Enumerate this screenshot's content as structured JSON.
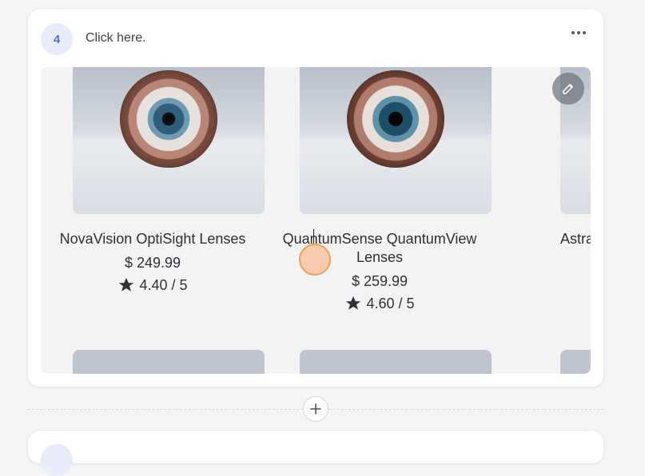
{
  "step": {
    "number": "4",
    "title": "Click here."
  },
  "products": [
    {
      "name": "NovaVision OptiSight Lenses",
      "price": "$ 249.99",
      "rating": "4.40 / 5"
    },
    {
      "name": "QuantumSense QuantumView Lenses",
      "price": "$ 259.99",
      "rating": "4.60 / 5"
    },
    {
      "name": "Astra",
      "price": "",
      "rating": ""
    }
  ],
  "icons": {
    "more": "more-horizontal-icon",
    "edit": "pencil-icon",
    "add": "plus-icon",
    "star": "star-icon"
  },
  "colors": {
    "badge_bg": "#e9ecfb",
    "badge_text": "#5a6ad8",
    "click_indicator": "#f0a253"
  }
}
